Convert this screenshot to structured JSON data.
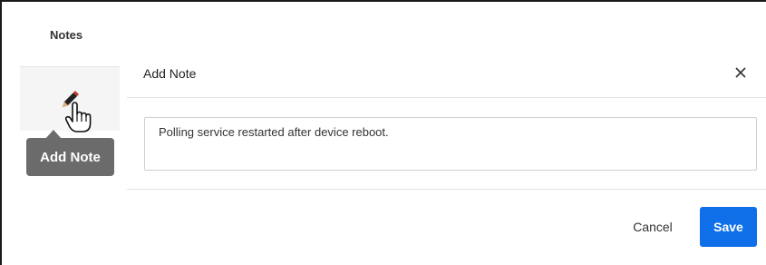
{
  "notes_column": {
    "header": "Notes",
    "edit_icon": "pencil-icon",
    "tooltip": "Add Note"
  },
  "dialog": {
    "title": "Add Note",
    "close_icon": "close-icon",
    "note_value": "Polling service restarted after device reboot.",
    "cancel_label": "Cancel",
    "save_label": "Save"
  },
  "colors": {
    "primary": "#0f6fe8",
    "tooltip_bg": "#6b6b6b"
  }
}
